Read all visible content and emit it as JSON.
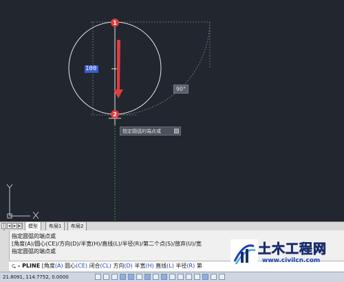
{
  "canvas": {
    "background": "#21262f",
    "dimension_value": "100",
    "angle_value": "90°",
    "tooltip_text": "指定圆弧的端点或",
    "grip_1": "1",
    "grip_2": "2",
    "arrow_color": "#e03c3c"
  },
  "tabs": {
    "model": "模型",
    "layout1": "布局1",
    "layout2": "布局2"
  },
  "command": {
    "history_1": "指定圆弧的端点或",
    "history_2": "[角度(A)/圆心(CE)/方向(D)/半宽(H)/直线(L)/半径(R)/第二个点(S)/放弃(U)/宽",
    "history_3": "指定圆弧的端点或",
    "prompt_icon": "⮎",
    "prompt_cmd": "- PLINE",
    "options": [
      {
        "text": "[角度"
      },
      {
        "key": "(A)"
      },
      {
        "text": " 圆心"
      },
      {
        "key": "(CE)"
      },
      {
        "text": " 闭合"
      },
      {
        "key": "(CL)"
      },
      {
        "text": " 方向"
      },
      {
        "key": "(D)"
      },
      {
        "text": " 半宽"
      },
      {
        "key": "(H)"
      },
      {
        "text": " 直线"
      },
      {
        "key": "(L)"
      },
      {
        "text": " 半径"
      },
      {
        "key": "(R)"
      },
      {
        "text": " 第"
      }
    ]
  },
  "status": {
    "coordinates": "21.8091,  114.7752, 0.0000"
  },
  "watermark": {
    "title": "土木工程网",
    "url": "www.civilcn.com"
  }
}
